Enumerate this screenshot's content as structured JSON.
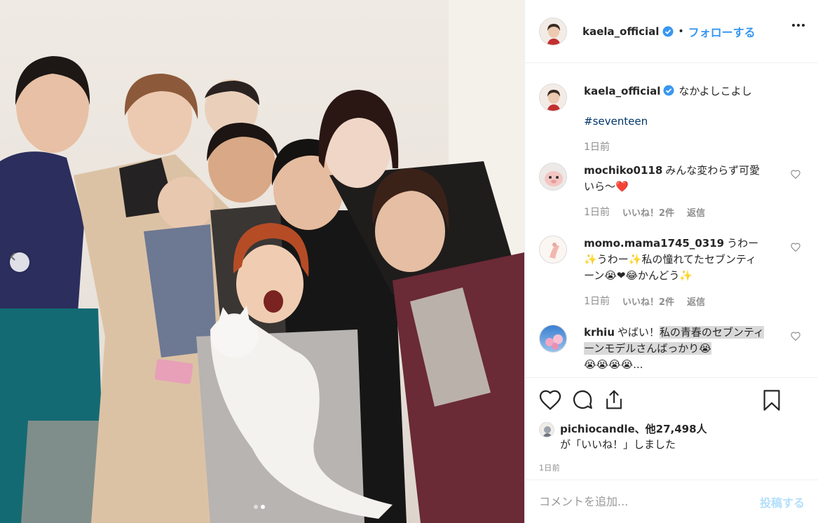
{
  "post": {
    "author": "kaela_official",
    "follow_label": "フォローする",
    "separator": "•"
  },
  "caption": {
    "username": "kaela_official",
    "text": "なかよしこよし",
    "hashtag": "#seventeen",
    "time": "1日前"
  },
  "comments": [
    {
      "username": "mochiko0118",
      "text": "みんな変わらず可愛いら〜❤️",
      "time": "1日前",
      "likes": "いいね！2件",
      "reply": "返信"
    },
    {
      "username": "momo.mama1745_0319",
      "text": "うわー✨うわー✨私の憧れてたセブンティーン😭❤😂かんどう✨",
      "time": "1日前",
      "likes": "いいね！2件",
      "reply": "返信"
    },
    {
      "username": "krhiu",
      "text_plain": "やばい！",
      "text_highlight": "私の青春のセブンティーンモデルさんばっかり😭",
      "text_tail": "😭😭😭😭..."
    }
  ],
  "likes": {
    "liker": "pichiocandle",
    "count_text": "、他27,498人",
    "suffix": "が「いいね！」しました"
  },
  "post_time": "1日前",
  "comment_box": {
    "placeholder": "コメントを追加...",
    "post_label": "投稿する"
  },
  "carousel": {
    "total": 2,
    "active": 2
  },
  "colors": {
    "accent": "#3897f0",
    "text": "#262626",
    "muted": "#8e8e8e",
    "hashtag": "#003569",
    "post_disabled": "#b2dffc",
    "border": "#efefef"
  },
  "icons": {
    "like": "heart-icon",
    "comment": "comment-icon",
    "share": "share-icon",
    "save": "bookmark-icon",
    "more": "more-options-icon",
    "verified": "verified-badge-icon",
    "prev": "chevron-left-icon"
  }
}
